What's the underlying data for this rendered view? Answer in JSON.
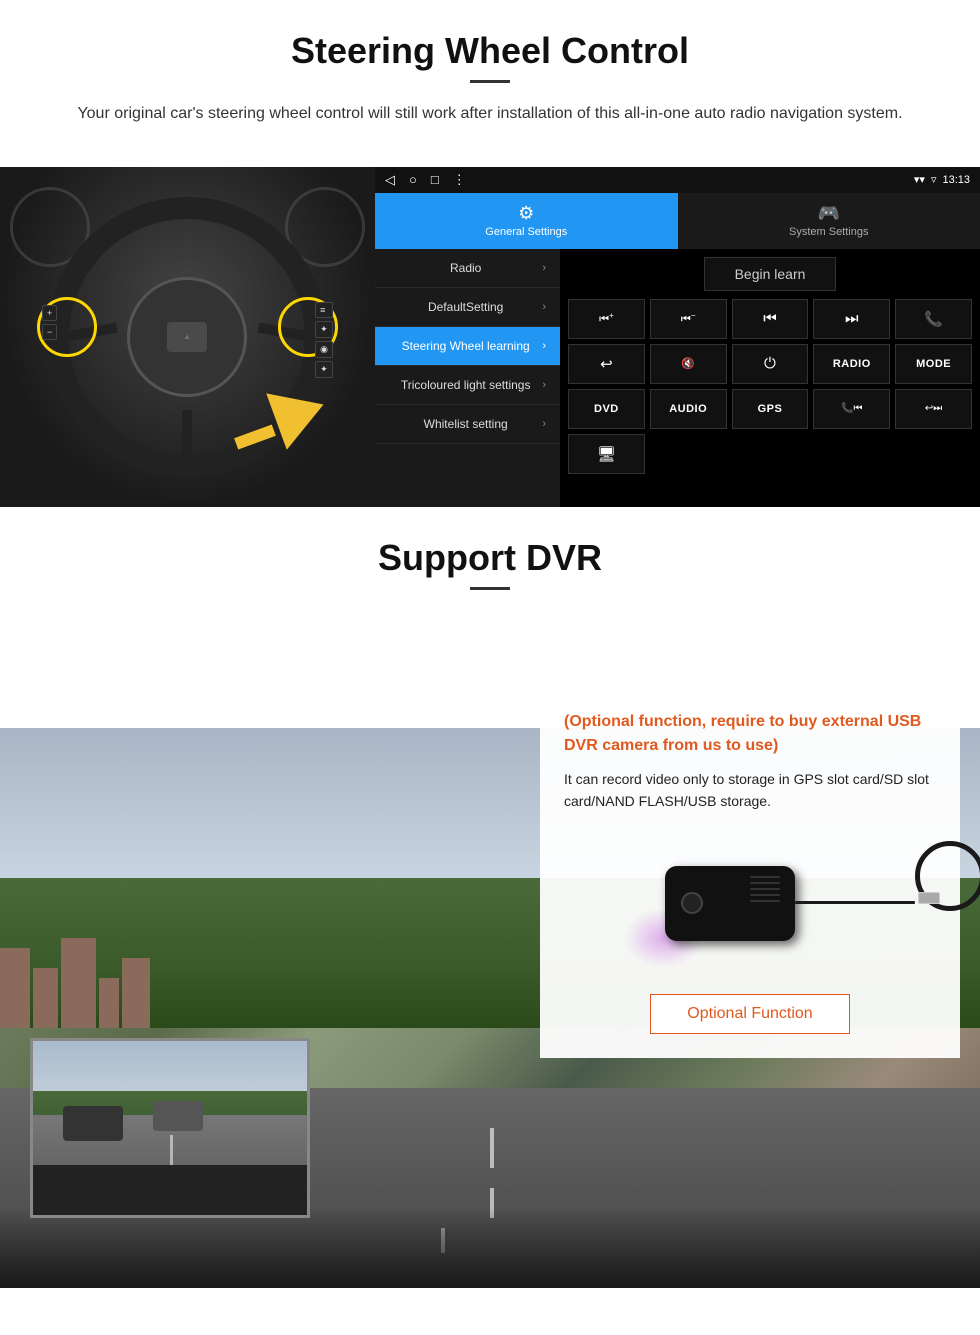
{
  "page": {
    "section1": {
      "title": "Steering Wheel Control",
      "subtitle": "Your original car's steering wheel control will still work after installation of this all-in-one auto radio navigation system.",
      "android": {
        "statusbar": {
          "time": "13:13",
          "nav_back": "◁",
          "nav_home": "○",
          "nav_recent": "□",
          "nav_dots": "⋮"
        },
        "tabs": [
          {
            "label": "General Settings",
            "icon": "⚙",
            "active": true
          },
          {
            "label": "System Settings",
            "icon": "🎮",
            "active": false
          }
        ],
        "menu_items": [
          {
            "label": "Radio",
            "active": false
          },
          {
            "label": "DefaultSetting",
            "active": false
          },
          {
            "label": "Steering Wheel learning",
            "active": true
          },
          {
            "label": "Tricoloured light settings",
            "active": false
          },
          {
            "label": "Whitelist setting",
            "active": false
          }
        ],
        "begin_learn_label": "Begin learn",
        "controls": [
          {
            "symbol": "⏮+",
            "text": false
          },
          {
            "symbol": "⏮-",
            "text": false
          },
          {
            "symbol": "⏮",
            "text": false
          },
          {
            "symbol": "⏭",
            "text": false
          },
          {
            "symbol": "📞",
            "text": false
          },
          {
            "symbol": "↩",
            "text": false
          },
          {
            "symbol": "🔇",
            "text": false
          },
          {
            "symbol": "⏻",
            "text": false
          },
          {
            "symbol": "RADIO",
            "text": true
          },
          {
            "symbol": "MODE",
            "text": true
          },
          {
            "symbol": "DVD",
            "text": true
          },
          {
            "symbol": "AUDIO",
            "text": true
          },
          {
            "symbol": "GPS",
            "text": true
          },
          {
            "symbol": "📞⏮",
            "text": false
          },
          {
            "symbol": "↩⏭",
            "text": false
          },
          {
            "symbol": "🖥",
            "text": false
          }
        ]
      }
    },
    "section2": {
      "title": "Support DVR",
      "info_box": {
        "optional_text": "(Optional function, require to buy external USB DVR camera from us to use)",
        "description": "It can record video only to storage in GPS slot card/SD slot card/NAND FLASH/USB storage.",
        "button_label": "Optional Function"
      }
    }
  }
}
